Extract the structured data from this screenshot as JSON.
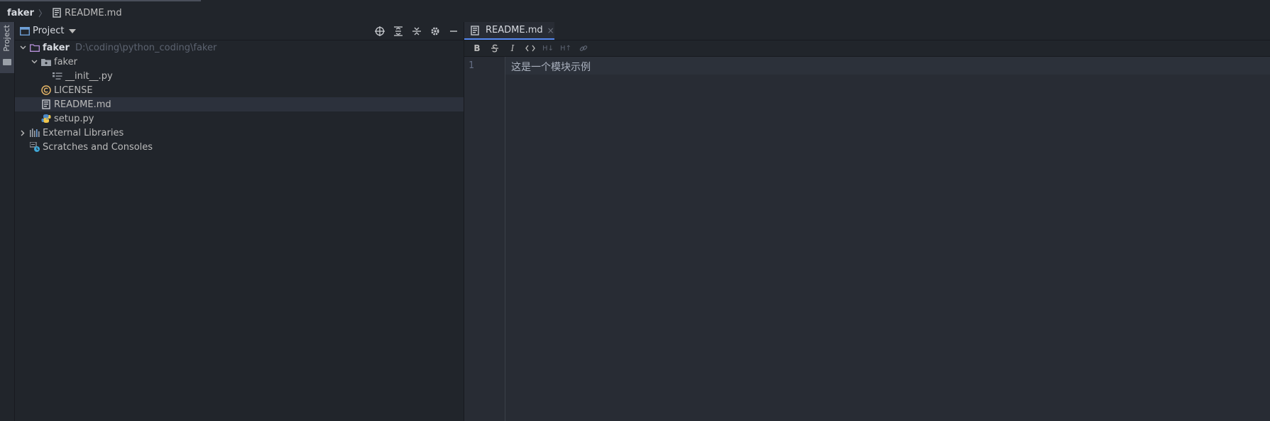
{
  "breadcrumb": {
    "root": "faker",
    "separator": "〉",
    "file": "README.md"
  },
  "toolwindow": {
    "tab_label": "Project"
  },
  "project_panel": {
    "title": "Project",
    "tools": [
      "locate-icon",
      "expand-all-icon",
      "collapse-all-icon",
      "gear-icon",
      "minimize-icon"
    ]
  },
  "tree": {
    "root_name": "faker",
    "root_path": "D:\\coding\\python_coding\\faker",
    "pkg_folder": "faker",
    "init_file": "__init__.py",
    "license_file": "LICENSE",
    "readme_file": "README.md",
    "setup_file": "setup.py",
    "external_libraries": "External Libraries",
    "scratches": "Scratches and Consoles"
  },
  "editor": {
    "tab_label": "README.md",
    "tab_close": "×",
    "md_toolbar": [
      "B",
      "S",
      "I",
      "<>",
      "H↓",
      "H↑",
      "link"
    ],
    "line_number": "1",
    "line_text": "这是一个模块示例"
  },
  "colors": {
    "accent": "#568af2",
    "panel_bg": "#21252b",
    "editor_bg": "#282c34"
  }
}
